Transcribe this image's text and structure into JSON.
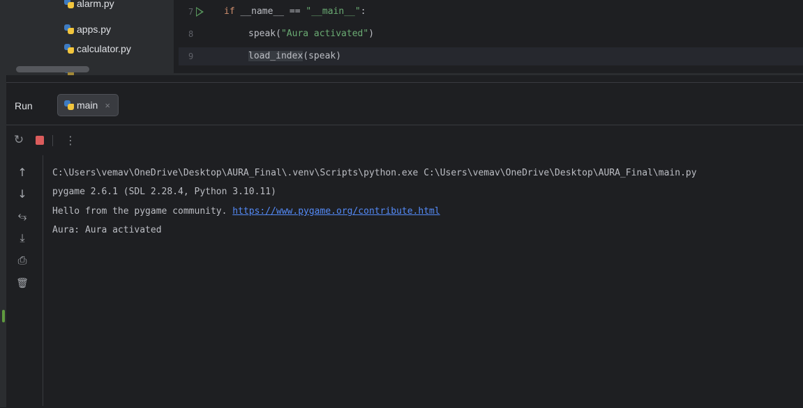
{
  "project": {
    "files": [
      {
        "name": "alarm.py"
      },
      {
        "name": "apps.py"
      },
      {
        "name": "calculator.py"
      }
    ]
  },
  "editor": {
    "lines": [
      {
        "number": "7",
        "kw": "if",
        "rest_pre": " __name__ == ",
        "str": "\"__main__\"",
        "rest_post": ":"
      },
      {
        "number": "8",
        "call": "speak(",
        "str": "\"Aura activated\"",
        "close": ")"
      },
      {
        "number": "9",
        "ident": "load_index",
        "args": "(speak)"
      }
    ]
  },
  "run": {
    "title": "Run",
    "tab_label": "main",
    "tab_close": "×"
  },
  "toolbar": {
    "rerun_icon": "↻",
    "more_icon": "⋮"
  },
  "side_actions": [
    {
      "icon": "↑",
      "name": "scroll-up-icon"
    },
    {
      "icon": "↓",
      "name": "scroll-down-icon"
    },
    {
      "icon": "⥃",
      "name": "soft-wrap-icon"
    },
    {
      "icon": "⤓",
      "name": "scroll-to-end-icon"
    },
    {
      "icon": "⎙",
      "name": "print-icon"
    },
    {
      "icon": "🗑",
      "name": "trash-icon"
    }
  ],
  "console": {
    "line1": "C:\\Users\\vemav\\OneDrive\\Desktop\\AURA_Final\\.venv\\Scripts\\python.exe C:\\Users\\vemav\\OneDrive\\Desktop\\AURA_Final\\main.py",
    "line2": "pygame 2.6.1 (SDL 2.28.4, Python 3.10.11)",
    "line3_text": "Hello from the pygame community. ",
    "line3_link": "https://www.pygame.org/contribute.html",
    "line4": "Aura: Aura activated"
  },
  "colors": {
    "background": "#1e1f22",
    "panel": "#2b2d30",
    "keyword": "#cf8e6d",
    "string": "#6aab73",
    "link": "#548af7",
    "stop": "#db5c5c"
  }
}
